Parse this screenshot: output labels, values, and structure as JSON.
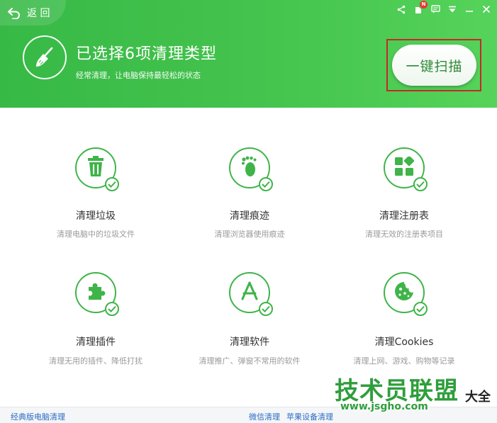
{
  "header": {
    "back_label": "返 回",
    "title": "已选择6项清理类型",
    "subtitle": "经常清理，让电脑保持最轻松的状态",
    "scan_button": "一键扫描",
    "notification_badge": "N",
    "colors": {
      "primary": "#3fb449",
      "header_start": "#37b946",
      "header_end": "#55d35a",
      "highlight_border": "#c62828"
    }
  },
  "window_controls": {
    "icons": [
      "share-icon",
      "notification-icon",
      "message-icon",
      "menu-icon",
      "minimize-icon",
      "close-icon"
    ]
  },
  "items": [
    {
      "title": "清理垃圾",
      "desc": "清理电脑中的垃圾文件",
      "icon": "trash-icon",
      "checked": true
    },
    {
      "title": "清理痕迹",
      "desc": "清理浏览器使用痕迹",
      "icon": "footprint-icon",
      "checked": true
    },
    {
      "title": "清理注册表",
      "desc": "清理无效的注册表项目",
      "icon": "registry-icon",
      "checked": true
    },
    {
      "title": "清理插件",
      "desc": "清理无用的插件、降低打扰",
      "icon": "puzzle-icon",
      "checked": true
    },
    {
      "title": "清理软件",
      "desc": "清理推广、弹窗不常用的软件",
      "icon": "app-store-icon",
      "checked": true
    },
    {
      "title": "清理Cookies",
      "desc": "清理上网、游戏、购物等记录",
      "icon": "cookie-icon",
      "checked": true
    }
  ],
  "footer": {
    "classic_link": "经典版电脑清理",
    "wechat_link": "微信清理",
    "apple_link": "苹果设备清理"
  },
  "watermark": {
    "brand": "技术员联盟",
    "site": "www.jsgho.com",
    "suffix": "大全"
  }
}
